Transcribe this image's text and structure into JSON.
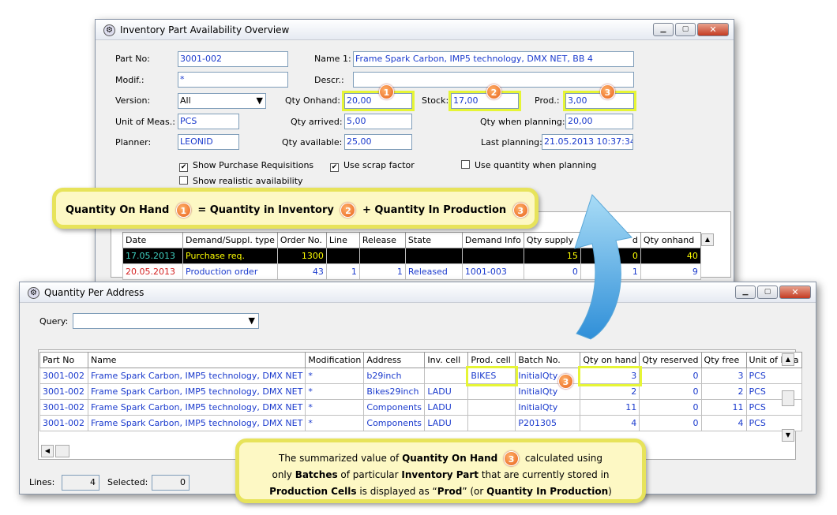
{
  "win1": {
    "title": "Inventory Part Availability Overview",
    "part_no_label": "Part No:",
    "part_no": "3001-002",
    "name1_label": "Name 1:",
    "name1": "Frame Spark Carbon, IMP5 technology, DMX NET, BB 4",
    "modif_label": "Modif.:",
    "modif": "*",
    "descr_label": "Descr.:",
    "descr": "",
    "version_label": "Version:",
    "version": "All",
    "qty_onhand_label": "Qty Onhand:",
    "qty_onhand": "20,00",
    "stock_label": "Stock:",
    "stock": "17,00",
    "prod_label": "Prod.:",
    "prod": "3,00",
    "uom_label": "Unit of Meas.:",
    "uom": "PCS",
    "qty_arrived_label": "Qty arrived:",
    "qty_arrived": "5,00",
    "qty_planning_label": "Qty when planning:",
    "qty_planning": "20,00",
    "planner_label": "Planner:",
    "planner": "LEONID",
    "qty_available_label": "Qty available:",
    "qty_available": "25,00",
    "last_planning_label": "Last planning:",
    "last_planning": "21.05.2013 10:37:34",
    "chk_purchase": "Show Purchase Requisitions",
    "chk_scrap": "Use scrap factor",
    "chk_qty_planning": "Use quantity when planning",
    "chk_realistic": "Show realistic availability",
    "grid_headers": [
      "Date",
      "Demand/Suppl. type",
      "Order No.",
      "Line",
      "Release",
      "State",
      "Demand Info",
      "Qty supply",
      "d",
      "Qty onhand"
    ],
    "grid_rows": [
      [
        "17.05.2013",
        "Purchase req.",
        "1300",
        "",
        "",
        "",
        "",
        "15",
        "0",
        "40"
      ],
      [
        "20.05.2013",
        "Production order",
        "43",
        "1",
        "1",
        "Released",
        "1001-003",
        "0",
        "1",
        "9"
      ]
    ]
  },
  "callout1": {
    "a": "Quantity On Hand",
    "b": "= Quantity in Inventory",
    "c": "+ Quantity In Production",
    "n1": "1",
    "n2": "2",
    "n3": "3"
  },
  "win2": {
    "title": "Quantity Per Address",
    "query_label": "Query:",
    "headers": [
      "Part No",
      "Name",
      "Modification",
      "Address",
      "Inv. cell",
      "Prod. cell",
      "Batch No.",
      "Qty on hand",
      "Qty reserved",
      "Qty free",
      "Unit of Mea"
    ],
    "rows": [
      [
        "3001-002",
        "Frame Spark Carbon, IMP5 technology, DMX NET",
        "*",
        "b29inch",
        "",
        "BIKES",
        "InitialQty",
        "3",
        "0",
        "3",
        "PCS"
      ],
      [
        "3001-002",
        "Frame Spark Carbon, IMP5 technology, DMX NET",
        "*",
        "Bikes29inch",
        "LADU",
        "",
        "InitialQty",
        "2",
        "0",
        "2",
        "PCS"
      ],
      [
        "3001-002",
        "Frame Spark Carbon, IMP5 technology, DMX NET",
        "*",
        "Components",
        "LADU",
        "",
        "InitialQty",
        "11",
        "0",
        "11",
        "PCS"
      ],
      [
        "3001-002",
        "Frame Spark Carbon, IMP5 technology, DMX NET",
        "*",
        "Components",
        "LADU",
        "",
        "P201305",
        "4",
        "0",
        "4",
        "PCS"
      ]
    ],
    "lines_label": "Lines:",
    "lines": "4",
    "selected_label": "Selected:",
    "selected": "0"
  },
  "callout2": {
    "l1a": "The summarized value of ",
    "l1b": "Quantity On Hand",
    "l1c": "calculated using",
    "l2a": "only ",
    "l2b": "Batches",
    "l2c": " of particular ",
    "l2d": "Inventory Part",
    "l2e": " that are currently stored in",
    "l3a": "Production Cells",
    "l3b": " is displayed as “",
    "l3c": "Prod",
    "l3d": "” (or ",
    "l3e": "Quantity In Production",
    "l3f": ")",
    "n": "3"
  },
  "colors": {
    "accent": "#1a3acd",
    "highlight": "#e6f535",
    "badge": "#e8621c",
    "arrow": "#5bb7ea"
  }
}
